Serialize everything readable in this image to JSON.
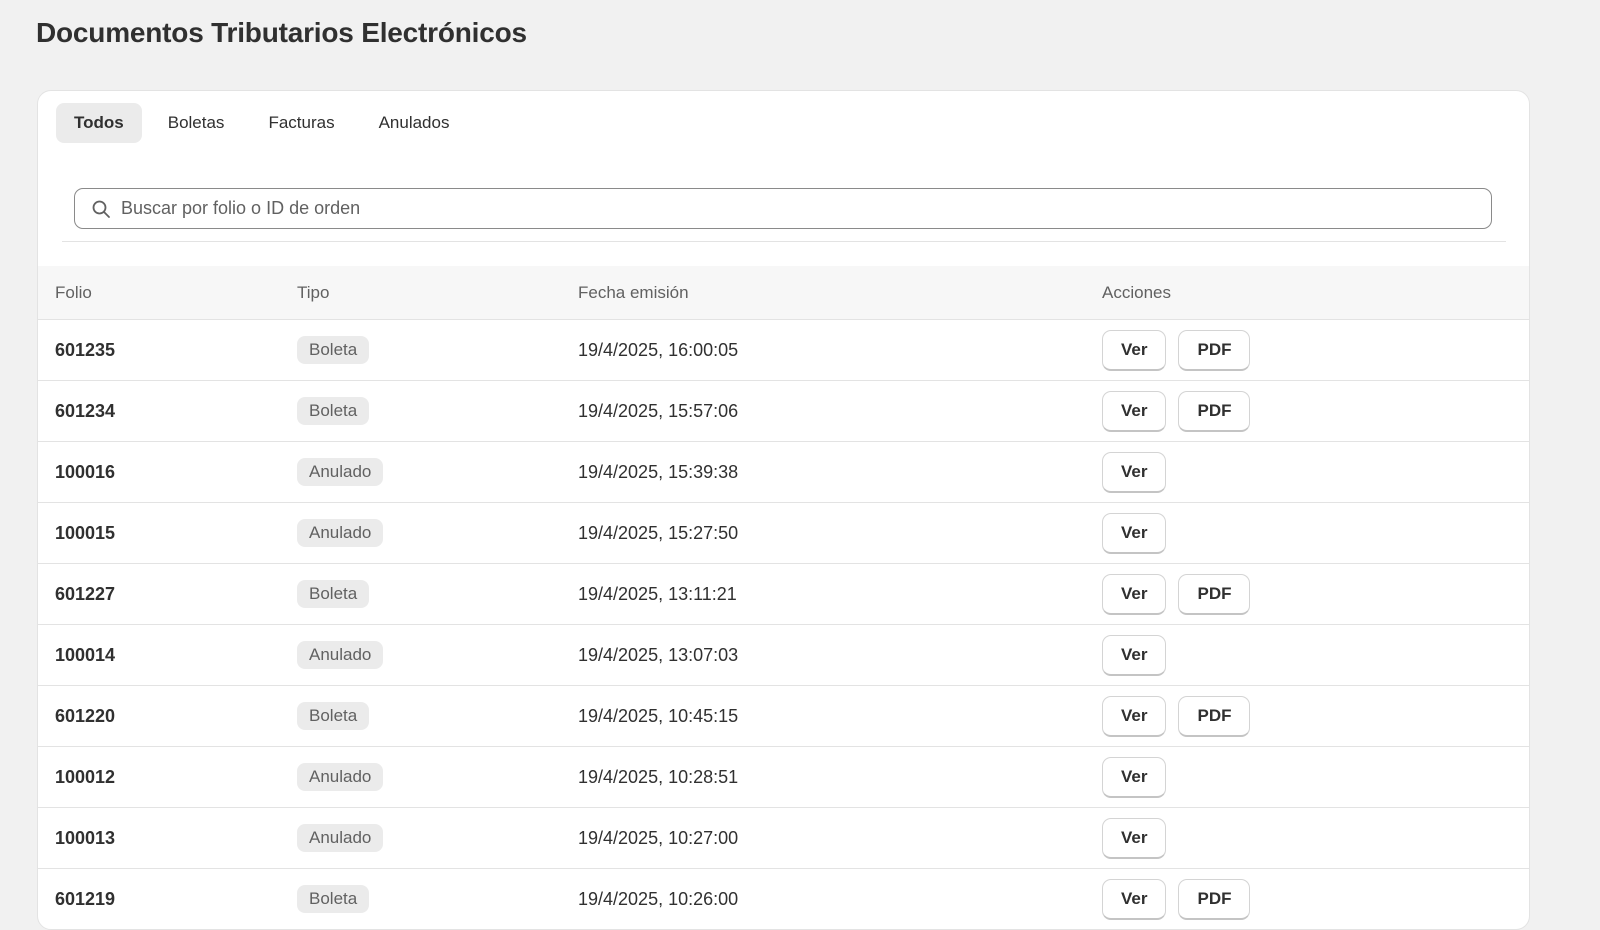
{
  "page": {
    "title": "Documentos Tributarios Electrónicos"
  },
  "tabs": [
    {
      "label": "Todos",
      "active": true
    },
    {
      "label": "Boletas",
      "active": false
    },
    {
      "label": "Facturas",
      "active": false
    },
    {
      "label": "Anulados",
      "active": false
    }
  ],
  "search": {
    "placeholder": "Buscar por folio o ID de orden",
    "value": "",
    "icon": "search-icon"
  },
  "table": {
    "headers": {
      "folio": "Folio",
      "tipo": "Tipo",
      "fecha": "Fecha emisión",
      "acciones": "Acciones"
    },
    "rows": [
      {
        "folio": "601235",
        "tipo": "Boleta",
        "fecha": "19/4/2025, 16:00:05",
        "actions": [
          "Ver",
          "PDF"
        ]
      },
      {
        "folio": "601234",
        "tipo": "Boleta",
        "fecha": "19/4/2025, 15:57:06",
        "actions": [
          "Ver",
          "PDF"
        ]
      },
      {
        "folio": "100016",
        "tipo": "Anulado",
        "fecha": "19/4/2025, 15:39:38",
        "actions": [
          "Ver"
        ]
      },
      {
        "folio": "100015",
        "tipo": "Anulado",
        "fecha": "19/4/2025, 15:27:50",
        "actions": [
          "Ver"
        ]
      },
      {
        "folio": "601227",
        "tipo": "Boleta",
        "fecha": "19/4/2025, 13:11:21",
        "actions": [
          "Ver",
          "PDF"
        ]
      },
      {
        "folio": "100014",
        "tipo": "Anulado",
        "fecha": "19/4/2025, 13:07:03",
        "actions": [
          "Ver"
        ]
      },
      {
        "folio": "601220",
        "tipo": "Boleta",
        "fecha": "19/4/2025, 10:45:15",
        "actions": [
          "Ver",
          "PDF"
        ]
      },
      {
        "folio": "100012",
        "tipo": "Anulado",
        "fecha": "19/4/2025, 10:28:51",
        "actions": [
          "Ver"
        ]
      },
      {
        "folio": "100013",
        "tipo": "Anulado",
        "fecha": "19/4/2025, 10:27:00",
        "actions": [
          "Ver"
        ]
      },
      {
        "folio": "601219",
        "tipo": "Boleta",
        "fecha": "19/4/2025, 10:26:00",
        "actions": [
          "Ver",
          "PDF"
        ]
      }
    ]
  },
  "colors": {
    "background": "#f1f1f1",
    "card": "#ffffff",
    "badge": "#ebebeb",
    "text": "#303030",
    "muted": "#616161"
  }
}
